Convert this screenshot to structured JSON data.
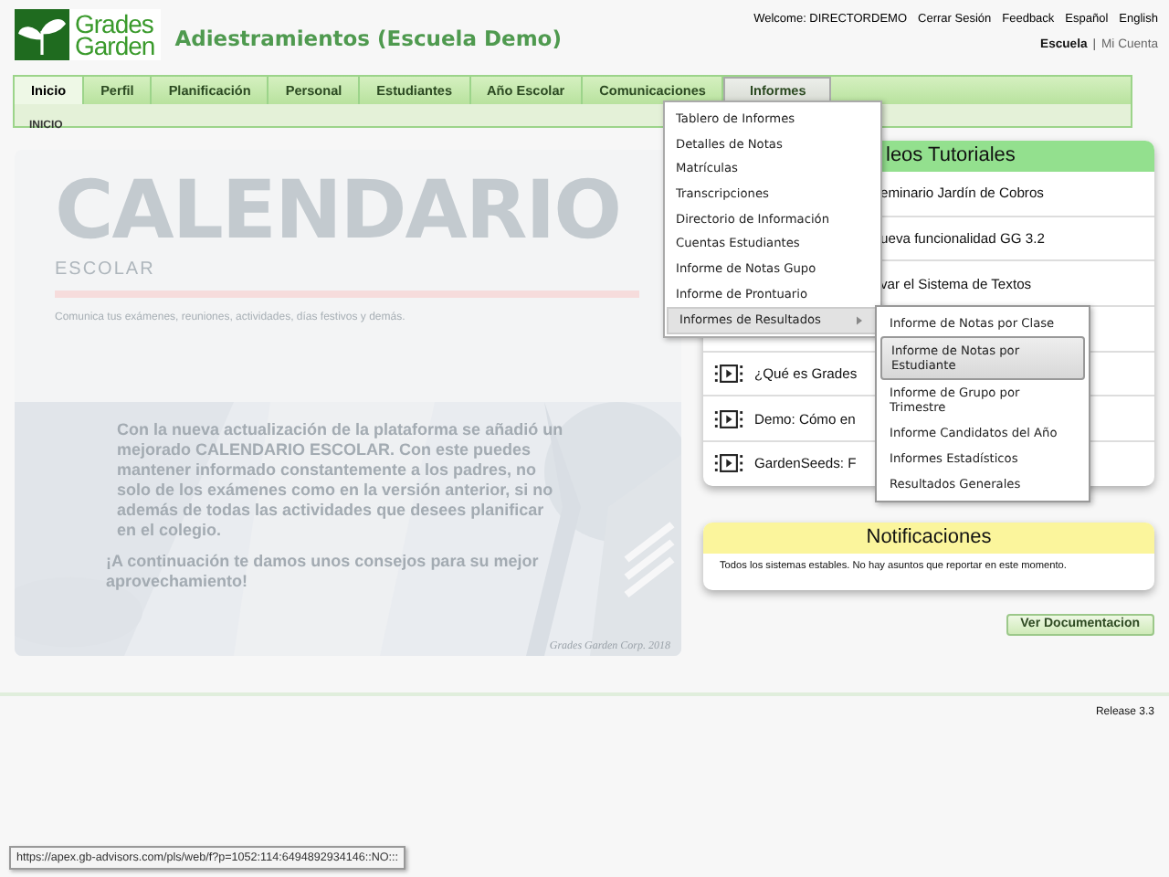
{
  "header": {
    "logo_lines": [
      "Grades",
      "Garden"
    ],
    "title": "Adiestramientos (Escuela Demo)",
    "user_links": [
      "Welcome: DIRECTORDEMO",
      "Cerrar Sesión",
      "Feedback",
      "Español",
      "English"
    ],
    "account_separator": "|",
    "account_links": [
      {
        "label": "Escuela",
        "selected": true
      },
      {
        "label": "Mi Cuenta",
        "selected": false
      }
    ]
  },
  "nav": {
    "tabs": [
      {
        "label": "Inicio",
        "selected": true,
        "open": false
      },
      {
        "label": "Perfil",
        "selected": false,
        "open": false
      },
      {
        "label": "Planificación",
        "selected": false,
        "open": false
      },
      {
        "label": "Personal",
        "selected": false,
        "open": false
      },
      {
        "label": "Estudiantes",
        "selected": false,
        "open": false
      },
      {
        "label": "Año Escolar",
        "selected": false,
        "open": false
      },
      {
        "label": "Comunicaciones",
        "selected": false,
        "open": false
      },
      {
        "label": "Informes",
        "selected": false,
        "open": true
      }
    ],
    "breadcrumb": "INICIO"
  },
  "banner": {
    "title": "CALENDARIO",
    "subtitle": "ESCOLAR",
    "tagline": "Comunica tus exámenes, reuniones, actividades, días festivos y demás.",
    "paragraphs": [
      "Con la nueva actualización de la plataforma se añadió un mejorado CALENDARIO ESCOLAR. Con este puedes mantener informado constantemente a los padres, no solo de los exámenes como en la versión anterior, si no además de todas las actividades que desees planificar en el colegio.",
      "¡A continuación te damos unos consejos para su mejor aprovechamiento!"
    ],
    "credit": "Grades Garden Corp. 2018"
  },
  "videos": {
    "title": "leos Tutoriales",
    "items": [
      {
        "kind": "cut",
        "title": "eminario Jardín de Cobros"
      },
      {
        "kind": "cut",
        "title": "ueva funcionalidad GG 3.2"
      },
      {
        "kind": "cut",
        "title": "var el Sistema de Textos"
      },
      {
        "kind": "hidden"
      },
      {
        "kind": "video",
        "title": "¿Qué es Grades"
      },
      {
        "kind": "video",
        "title": "Demo: Cómo en"
      },
      {
        "kind": "video",
        "title": "GardenSeeds: F"
      }
    ]
  },
  "notifications": {
    "title": "Notificaciones",
    "message": "Todos los sistemas estables. No hay asuntos que reportar en este momento."
  },
  "doc_button": "Ver Documentacion",
  "release": "Release 3.3",
  "menu": {
    "items": [
      {
        "label": "Tablero de Informes",
        "selected": false,
        "submenu": false
      },
      {
        "label": "Detalles de Notas",
        "selected": false,
        "submenu": false
      },
      {
        "label": "Matrículas",
        "selected": false,
        "submenu": false
      },
      {
        "label": "Transcripciones",
        "selected": false,
        "submenu": false
      },
      {
        "label": "Directorio de Información",
        "selected": false,
        "submenu": false
      },
      {
        "label": "Cuentas Estudiantes",
        "selected": false,
        "submenu": false
      },
      {
        "label": "Informe de Notas Gupo",
        "selected": false,
        "submenu": false
      },
      {
        "label": "Informe de Prontuario",
        "selected": false,
        "submenu": false
      },
      {
        "label": "Informes de Resultados",
        "selected": true,
        "submenu": true
      }
    ]
  },
  "submenu": {
    "items": [
      {
        "label": "Informe de Notas por Clase",
        "selected": false
      },
      {
        "label": "Informe de Notas por Estudiante",
        "selected": true
      },
      {
        "label": "Informe de Grupo por Trimestre",
        "selected": false
      },
      {
        "label": "Informe Candidatos del Año",
        "selected": false
      },
      {
        "label": "Informes Estadísticos",
        "selected": false
      },
      {
        "label": "Resultados Generales",
        "selected": false
      }
    ]
  },
  "status_url": "https://apex.gb-advisors.com/pls/web/f?p=1052:114:6494892934146::NO:::"
}
